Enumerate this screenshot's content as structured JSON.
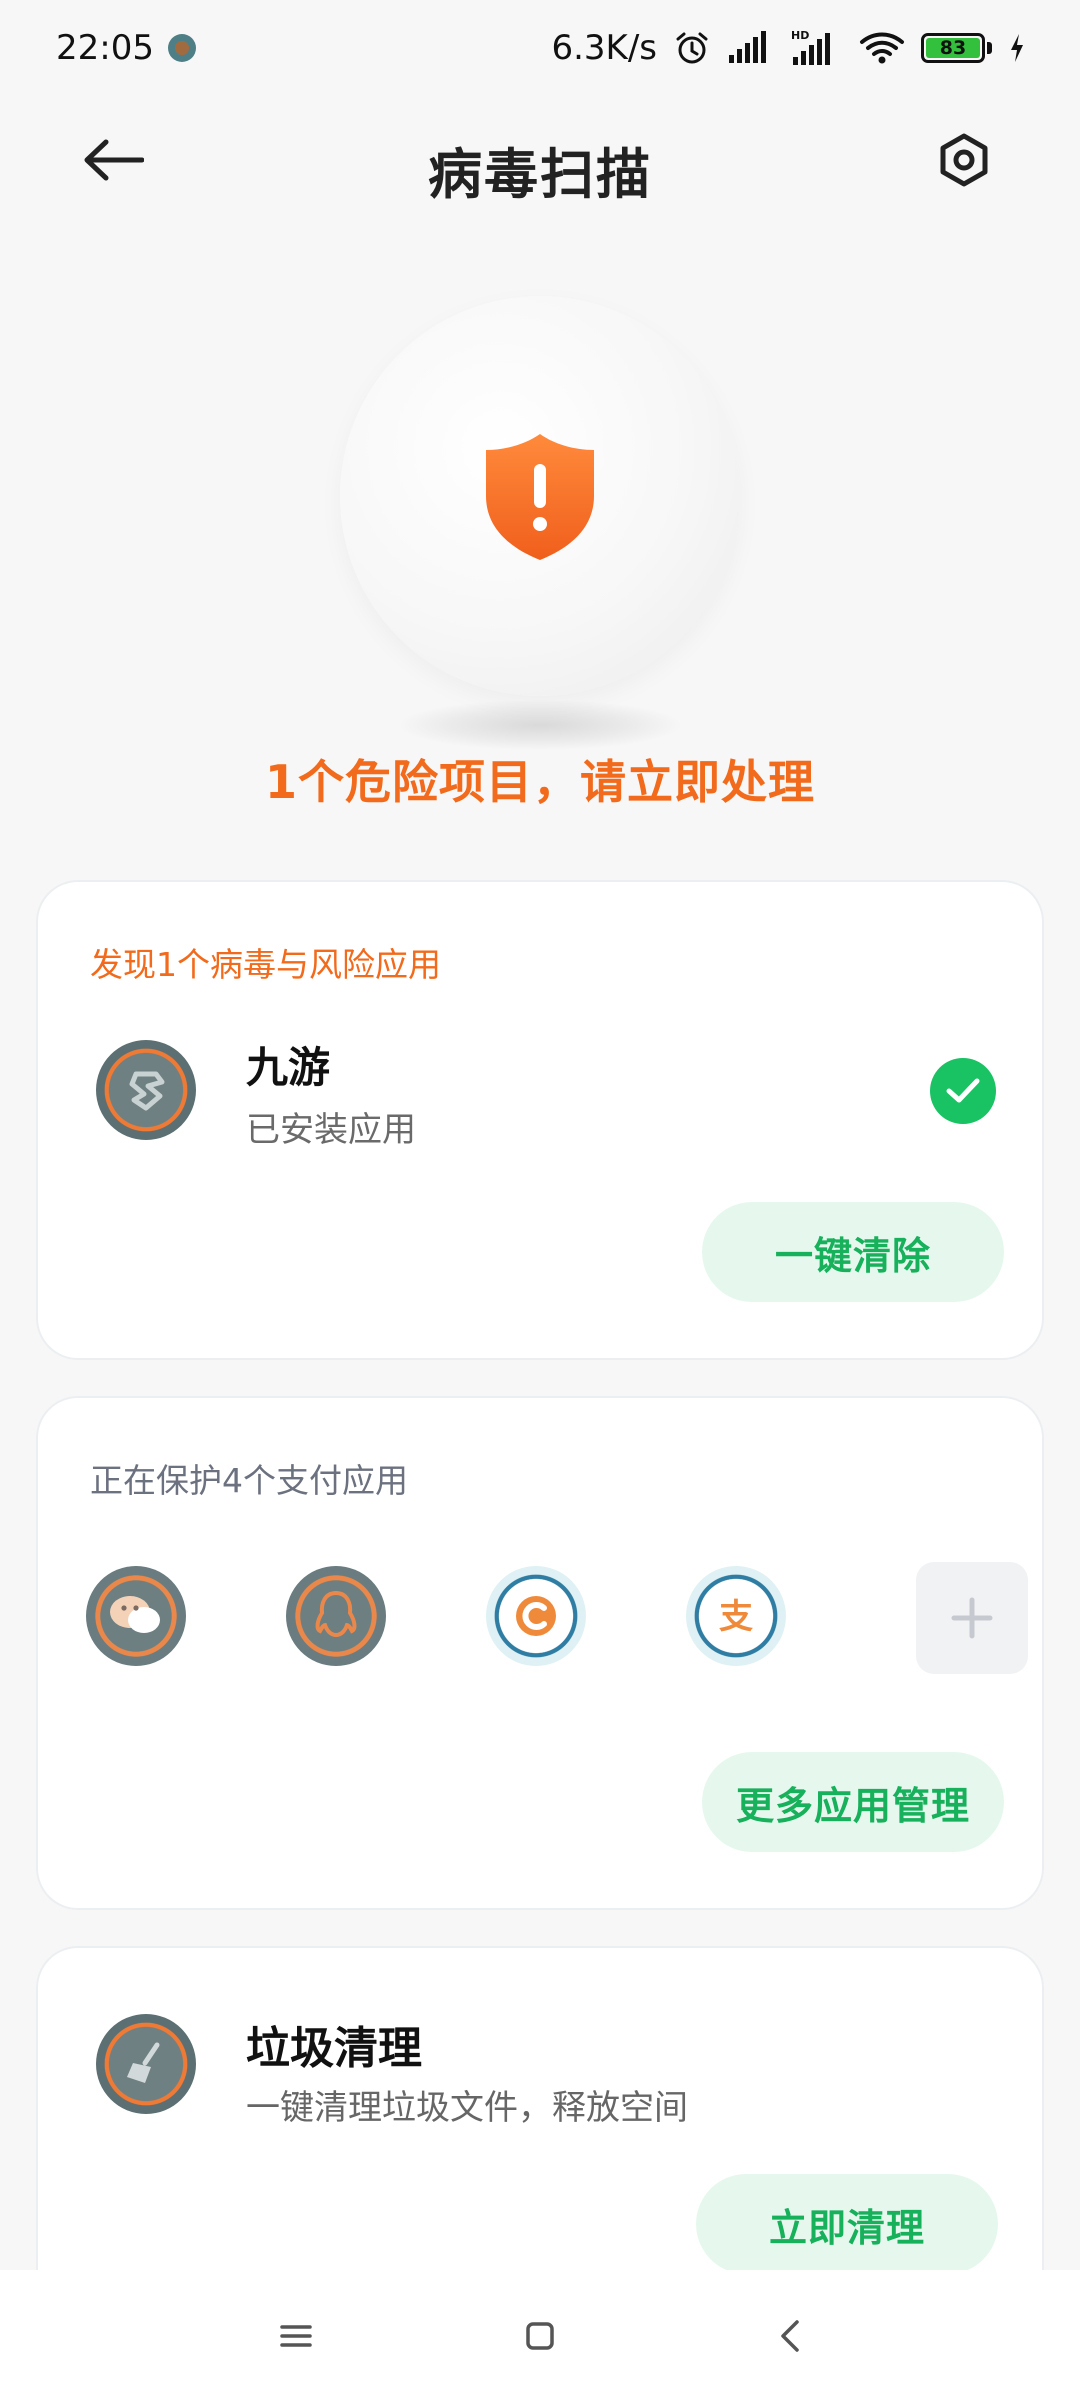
{
  "status_bar": {
    "time": "22:05",
    "network_speed": "6.3K/s",
    "signal_tag": "HD",
    "battery_level": "83"
  },
  "header": {
    "title": "病毒扫描"
  },
  "hero": {
    "status_text": "1个危险项目，请立即处理",
    "icon": "shield-warning-icon",
    "accent_color": "#f26a1b"
  },
  "threat_card": {
    "title": "发现1个病毒与风险应用",
    "app": {
      "name": "九游",
      "status": "已安装应用",
      "selected": true,
      "icon": "jiuyou-app-icon"
    },
    "button_label": "一键清除"
  },
  "payment_card": {
    "title": "正在保护4个支付应用",
    "apps": [
      {
        "icon": "wechat-app-icon",
        "glyph": "chat"
      },
      {
        "icon": "qq-app-icon",
        "glyph": "qq"
      },
      {
        "icon": "bank-app-icon",
        "glyph": "bank"
      },
      {
        "icon": "alipay-app-icon",
        "glyph": "支"
      }
    ],
    "add_icon": "plus-icon",
    "button_label": "更多应用管理"
  },
  "cleanup_card": {
    "title": "垃圾清理",
    "subtitle": "一键清理垃圾文件，释放空间",
    "icon": "broom-icon",
    "button_label": "立即清理"
  },
  "nav_bar": {
    "icons": [
      "menu-icon",
      "home-icon",
      "back-icon"
    ]
  },
  "colors": {
    "green": "#19c263",
    "orange": "#f26a1b",
    "pill_bg": "#e6f8ee"
  }
}
